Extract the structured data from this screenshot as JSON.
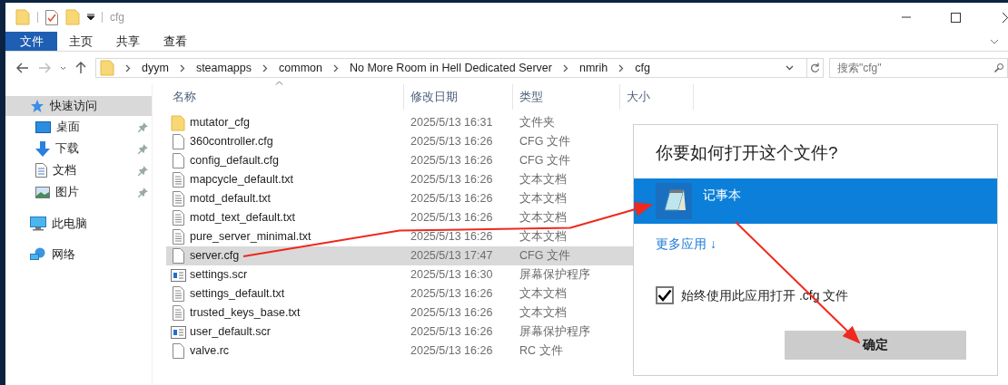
{
  "window": {
    "title": "cfg"
  },
  "ribbon_tabs": [
    {
      "label": "文件",
      "selected": true
    },
    {
      "label": "主页",
      "selected": false
    },
    {
      "label": "共享",
      "selected": false
    },
    {
      "label": "查看",
      "selected": false
    }
  ],
  "breadcrumb": [
    "dyym",
    "steamapps",
    "common",
    "No More Room in Hell Dedicated Server",
    "nmrih",
    "cfg"
  ],
  "search": {
    "placeholder": "搜索\"cfg\""
  },
  "sidebar": {
    "items": [
      {
        "label": "快速访问",
        "kind": "star",
        "selected": true,
        "children": [
          {
            "label": "桌面",
            "kind": "desktop",
            "pinned": true
          },
          {
            "label": "下载",
            "kind": "download",
            "pinned": true
          },
          {
            "label": "文档",
            "kind": "docs",
            "pinned": true
          },
          {
            "label": "图片",
            "kind": "pictures",
            "pinned": true
          }
        ]
      },
      {
        "label": "此电脑",
        "kind": "pc",
        "selected": false
      },
      {
        "label": "网络",
        "kind": "network",
        "selected": false
      }
    ]
  },
  "table": {
    "columns": [
      "名称",
      "修改日期",
      "类型",
      "大小"
    ],
    "rows": [
      {
        "name": "mutator_cfg",
        "kind": "folder",
        "date": "2025/5/13 16:31",
        "type": "文件夹",
        "selected": false
      },
      {
        "name": "360controller.cfg",
        "kind": "blank",
        "date": "2025/5/13 16:26",
        "type": "CFG 文件",
        "selected": false
      },
      {
        "name": "config_default.cfg",
        "kind": "blank",
        "date": "2025/5/13 16:26",
        "type": "CFG 文件",
        "selected": false
      },
      {
        "name": "mapcycle_default.txt",
        "kind": "text",
        "date": "2025/5/13 16:26",
        "type": "文本文档",
        "selected": false
      },
      {
        "name": "motd_default.txt",
        "kind": "text",
        "date": "2025/5/13 16:26",
        "type": "文本文档",
        "selected": false
      },
      {
        "name": "motd_text_default.txt",
        "kind": "text",
        "date": "2025/5/13 16:26",
        "type": "文本文档",
        "selected": false
      },
      {
        "name": "pure_server_minimal.txt",
        "kind": "text",
        "date": "2025/5/13 16:26",
        "type": "文本文档",
        "selected": false
      },
      {
        "name": "server.cfg",
        "kind": "blank",
        "date": "2025/5/13 17:47",
        "type": "CFG 文件",
        "selected": true
      },
      {
        "name": "settings.scr",
        "kind": "screensaver",
        "date": "2025/5/13 16:30",
        "type": "屏幕保护程序",
        "selected": false
      },
      {
        "name": "settings_default.txt",
        "kind": "text",
        "date": "2025/5/13 16:26",
        "type": "文本文档",
        "selected": false
      },
      {
        "name": "trusted_keys_base.txt",
        "kind": "text",
        "date": "2025/5/13 16:26",
        "type": "文本文档",
        "selected": false
      },
      {
        "name": "user_default.scr",
        "kind": "screensaver",
        "date": "2025/5/13 16:26",
        "type": "屏幕保护程序",
        "selected": false
      },
      {
        "name": "valve.rc",
        "kind": "blank",
        "date": "2025/5/13 16:26",
        "type": "RC 文件",
        "selected": false
      }
    ]
  },
  "dialog": {
    "title": "你要如何打开这个文件?",
    "apps": [
      {
        "label": "记事本",
        "selected": true
      }
    ],
    "more_link": "更多应用 ↓",
    "always_use": {
      "label": "始终使用此应用打开 .cfg 文件",
      "checked": true
    },
    "ok_button": "确定"
  }
}
